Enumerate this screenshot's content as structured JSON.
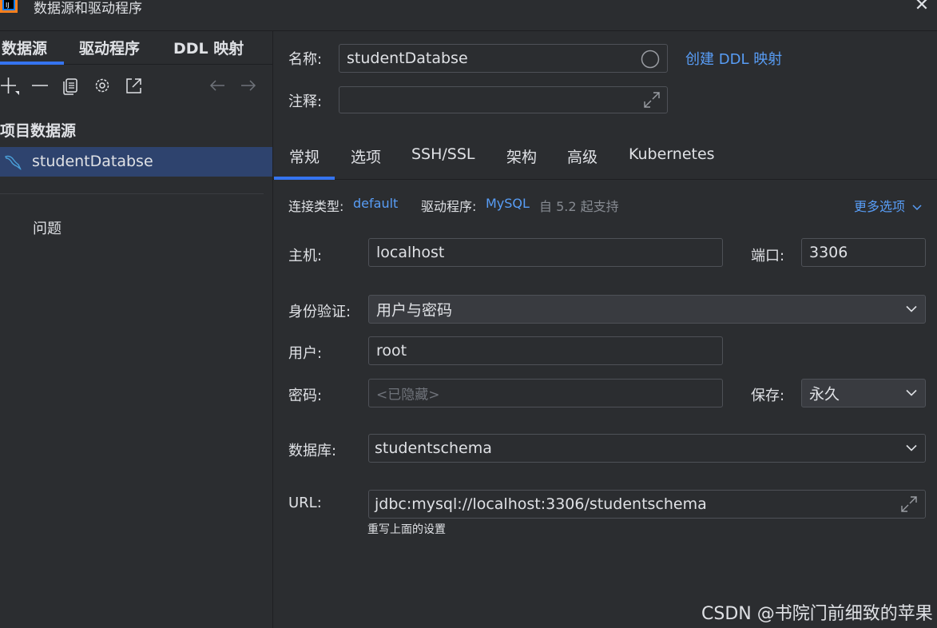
{
  "window": {
    "title": "数据源和驱动程序",
    "close_glyph": "✕"
  },
  "left": {
    "tabs": [
      {
        "label": "数据源",
        "active": true
      },
      {
        "label": "驱动程序",
        "active": false
      },
      {
        "label": "DDL 映射",
        "active": false
      }
    ],
    "toolbar_icons": [
      "add-icon",
      "remove-icon",
      "duplicate-icon",
      "settings-icon",
      "export-icon",
      "back-arrow-icon",
      "forward-arrow-icon"
    ],
    "section_header": "项目数据源",
    "datasources": [
      {
        "name": "studentDatabse",
        "icon": "mysql-dolphin-icon",
        "selected": true
      }
    ],
    "problems_label": "问题"
  },
  "right": {
    "name_label": "名称:",
    "name_value": "studentDatabse",
    "create_ddl_link": "创建 DDL 映射",
    "comment_label": "注释:",
    "comment_value": "",
    "tabs": [
      {
        "label": "常规",
        "active": true
      },
      {
        "label": "选项",
        "active": false
      },
      {
        "label": "SSH/SSL",
        "active": false
      },
      {
        "label": "架构",
        "active": false
      },
      {
        "label": "高级",
        "active": false
      },
      {
        "label": "Kubernetes",
        "active": false
      }
    ],
    "conn_type_label": "连接类型:",
    "conn_type_value": "default",
    "driver_label": "驱动程序:",
    "driver_value": "MySQL",
    "driver_note": "自 5.2 起支持",
    "more_options": "更多选项",
    "host_label": "主机:",
    "host_value": "localhost",
    "port_label": "端口:",
    "port_value": "3306",
    "auth_label": "身份验证:",
    "auth_value": "用户与密码",
    "user_label": "用户:",
    "user_value": "root",
    "password_label": "密码:",
    "password_placeholder": "<已隐藏>",
    "save_label": "保存:",
    "save_value": "永久",
    "database_label": "数据库:",
    "database_value": "studentschema",
    "url_label": "URL:",
    "url_value": "jdbc:mysql://localhost:3306/studentschema",
    "url_note": "重写上面的设置"
  },
  "watermark": "CSDN @书院门前细致的苹果",
  "colors": {
    "background": "#2b2d30",
    "accent": "#3574f0",
    "link": "#589df6",
    "selection": "#2e436e"
  }
}
